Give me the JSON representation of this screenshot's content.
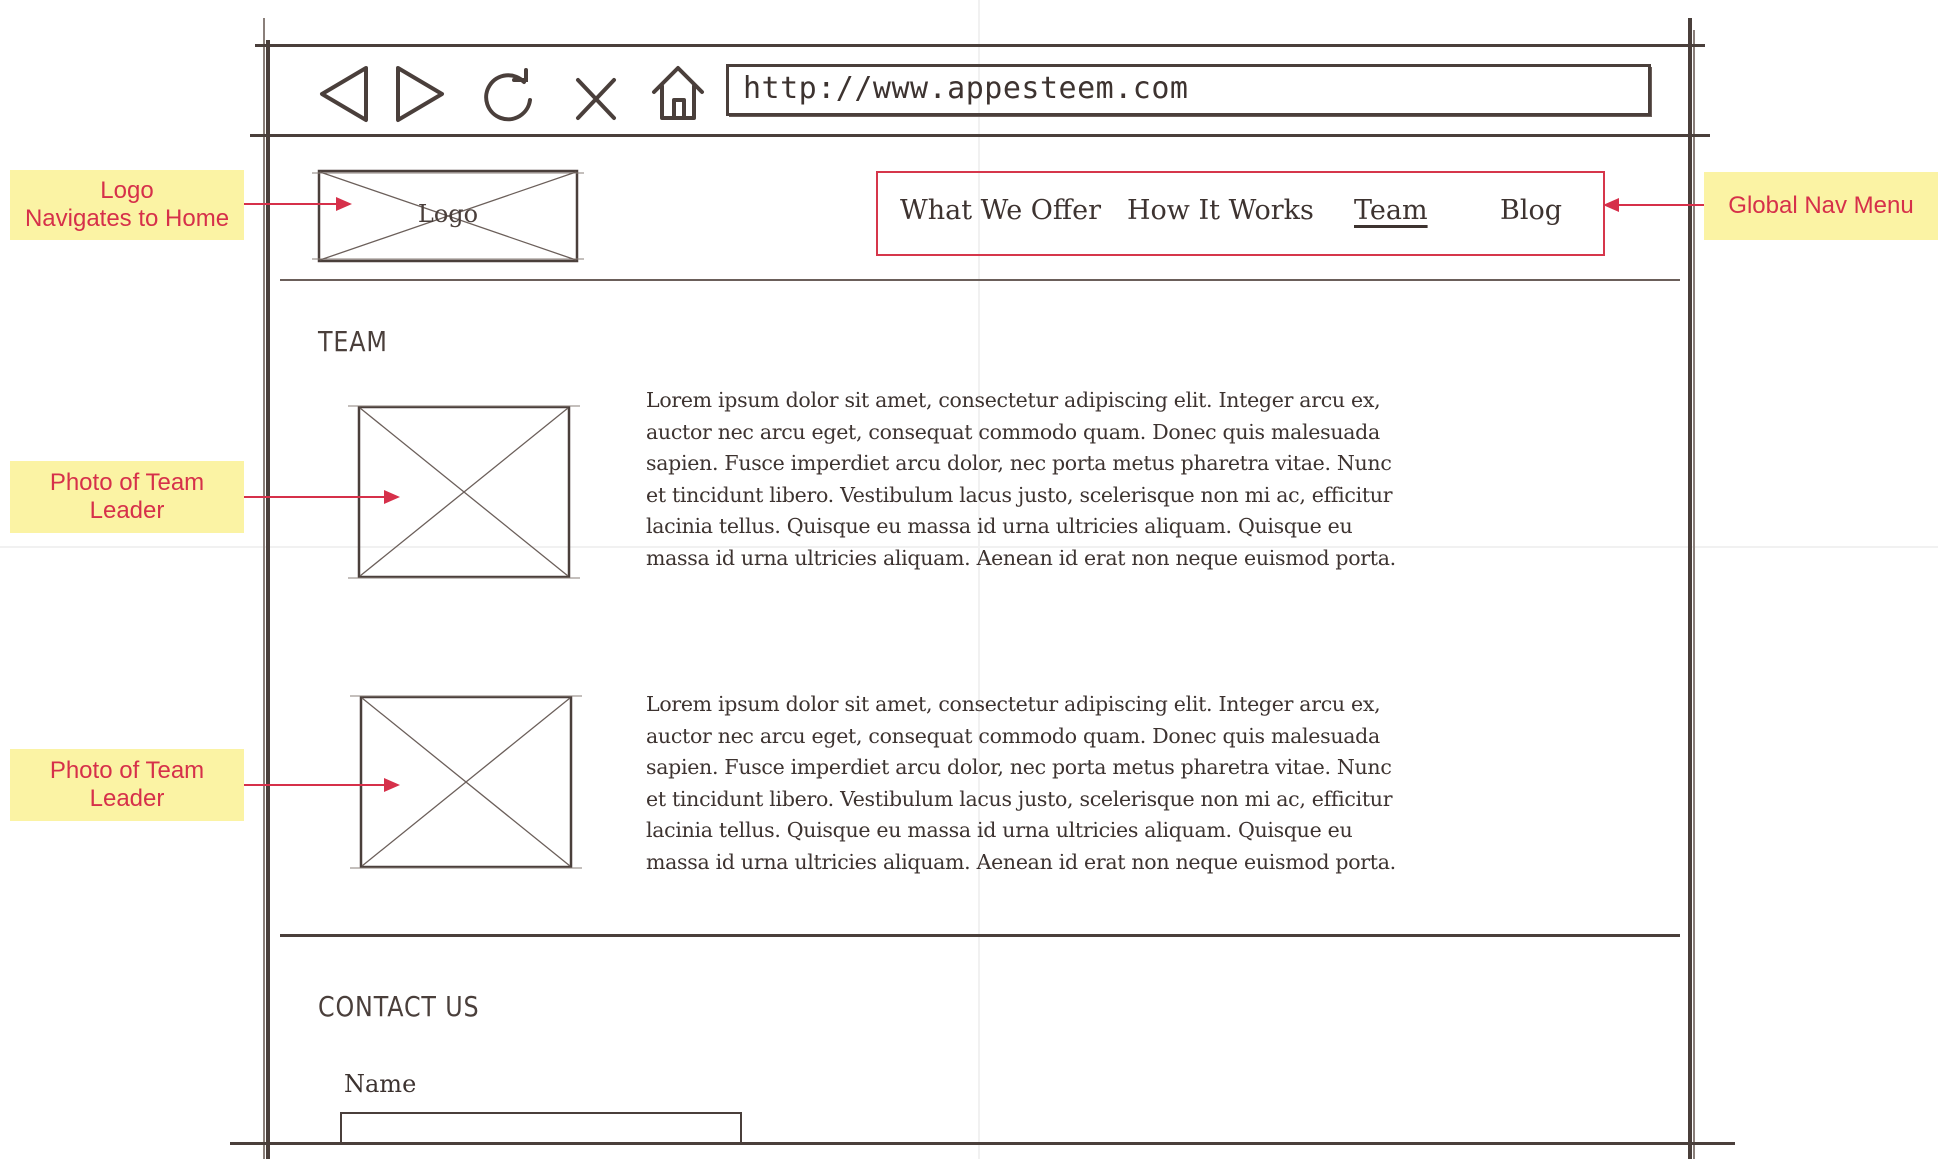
{
  "browser": {
    "url": "http://www.appesteem.com",
    "toolbar_icons": [
      "back-icon",
      "forward-icon",
      "reload-icon",
      "stop-icon",
      "home-icon"
    ]
  },
  "header": {
    "logo_label": "Logo",
    "nav": [
      {
        "label": "What We Offer"
      },
      {
        "label": "How It Works"
      },
      {
        "label": "Team",
        "active": true
      },
      {
        "label": "Blog"
      }
    ]
  },
  "team": {
    "heading": "TEAM",
    "members": [
      {
        "bio": "Lorem ipsum dolor sit amet, consectetur adipiscing elit. Integer arcu ex, auctor nec arcu eget, consequat commodo quam. Donec quis malesuada sapien. Fusce imperdiet arcu dolor, nec porta metus pharetra vitae. Nunc et tincidunt libero. Vestibulum lacus justo, scelerisque non mi ac, efficitur lacinia tellus. Quisque eu massa id urna ultricies aliquam.  Quisque eu massa id urna ultricies aliquam. Aenean id erat non neque euismod porta."
      },
      {
        "bio": "Lorem ipsum dolor sit amet, consectetur adipiscing elit. Integer arcu ex, auctor nec arcu eget, consequat commodo quam. Donec quis malesuada sapien. Fusce imperdiet arcu dolor, nec porta metus pharetra vitae. Nunc et tincidunt libero. Vestibulum lacus justo, scelerisque non mi ac, efficitur lacinia tellus. Quisque eu massa id urna ultricies aliquam.  Quisque eu massa id urna ultricies aliquam. Aenean id erat non neque euismod porta."
      }
    ]
  },
  "contact": {
    "heading": "CONTACT US",
    "name_label": "Name"
  },
  "annotations": {
    "logo": "Logo\nNavigates to Home",
    "nav": "Global Nav Menu",
    "photo_1": "Photo of Team\nLeader",
    "photo_2": "Photo of Team\nLeader"
  },
  "colors": {
    "ink": "#4a3f3b",
    "annotation_red": "#d6304a",
    "annotation_bg": "#fbf3a4"
  }
}
